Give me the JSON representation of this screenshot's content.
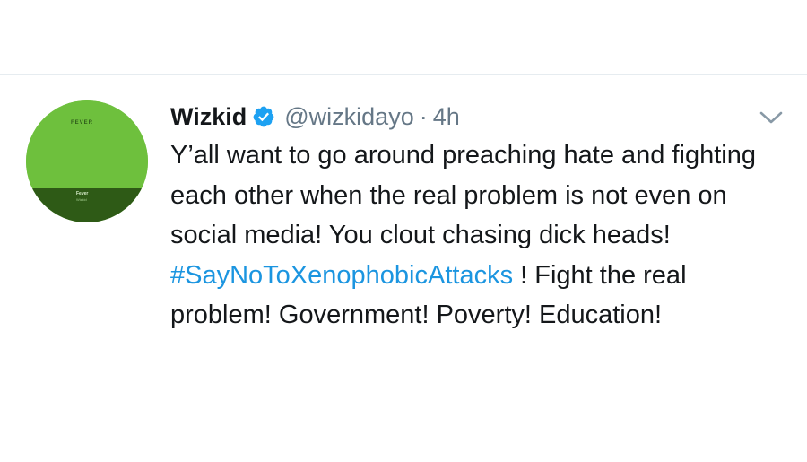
{
  "tweet": {
    "author_name": "Wizkid",
    "verified_icon": "verified-badge-icon",
    "handle": "@wizkidayo",
    "separator": "·",
    "time": "4h",
    "text_part1": "Y’all want to go around preaching hate and fighting each other when the real problem is not even on social media! You clout chasing dick heads! ",
    "hashtag": "#SayNoToXenophobicAttacks",
    "text_part2": " ! Fight the real problem! Government! Poverty! Education!",
    "menu_icon": "chevron-down-icon"
  },
  "avatar": {
    "cover_top_text": "FEVER",
    "cover_title": "Fever",
    "cover_subtitle": "Wizkid"
  },
  "colors": {
    "hashtag": "#1b95e0",
    "secondary_text": "#657786",
    "verified": "#1da1f2",
    "divider": "#e6ecf0"
  }
}
